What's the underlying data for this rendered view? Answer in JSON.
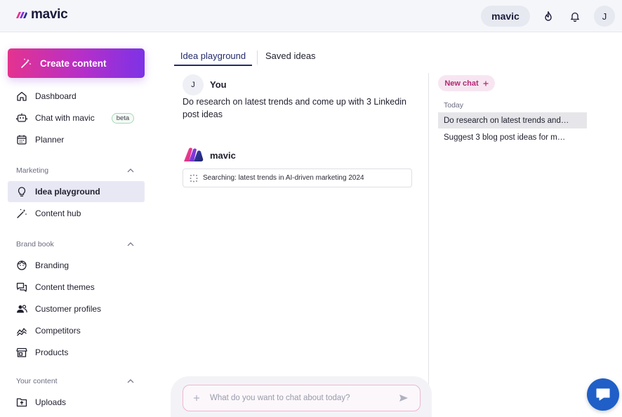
{
  "app": {
    "name": "mavic"
  },
  "header": {
    "workspace_label": "mavic",
    "avatar_initial": "J",
    "icons": [
      "fire-icon",
      "bell-icon"
    ]
  },
  "sidebar": {
    "create_label": "Create content",
    "items": [
      {
        "label": "Dashboard",
        "icon": "home-icon"
      },
      {
        "label": "Chat with mavic",
        "icon": "bot-icon",
        "badge": "beta"
      },
      {
        "label": "Planner",
        "icon": "calendar-icon"
      }
    ],
    "sections": [
      {
        "title": "Marketing",
        "items": [
          {
            "label": "Idea playground",
            "icon": "lightbulb-icon",
            "active": true
          },
          {
            "label": "Content hub",
            "icon": "wand-icon"
          }
        ]
      },
      {
        "title": "Brand book",
        "items": [
          {
            "label": "Branding",
            "icon": "face-icon"
          },
          {
            "label": "Content themes",
            "icon": "chat-bubbles-icon"
          },
          {
            "label": "Customer profiles",
            "icon": "people-icon"
          },
          {
            "label": "Competitors",
            "icon": "chart-icon"
          },
          {
            "label": "Products",
            "icon": "store-icon"
          }
        ]
      },
      {
        "title": "Your content",
        "items": [
          {
            "label": "Uploads",
            "icon": "folder-upload-icon"
          }
        ]
      }
    ]
  },
  "main": {
    "tabs": [
      {
        "label": "Idea playground",
        "active": true
      },
      {
        "label": "Saved ideas",
        "active": false
      }
    ],
    "messages": [
      {
        "author": "You",
        "avatar": "J",
        "text": "Do research on latest trends and come up with 3 Linkedin post ideas"
      },
      {
        "author": "mavic",
        "status": "Searching: latest trends in AI-driven marketing 2024"
      }
    ],
    "input": {
      "placeholder": "What do you want to chat about today?"
    }
  },
  "history": {
    "new_chat_label": "New chat",
    "group_label": "Today",
    "items": [
      {
        "title": "Do research on latest trends and…",
        "selected": true
      },
      {
        "title": "Suggest 3 blog post ideas for m…",
        "selected": false
      }
    ]
  },
  "colors": {
    "brand_pink": "#e4338f",
    "brand_purple": "#7d32e6",
    "brand_navy": "#232b6b",
    "help_blue": "#1f5fc7"
  }
}
